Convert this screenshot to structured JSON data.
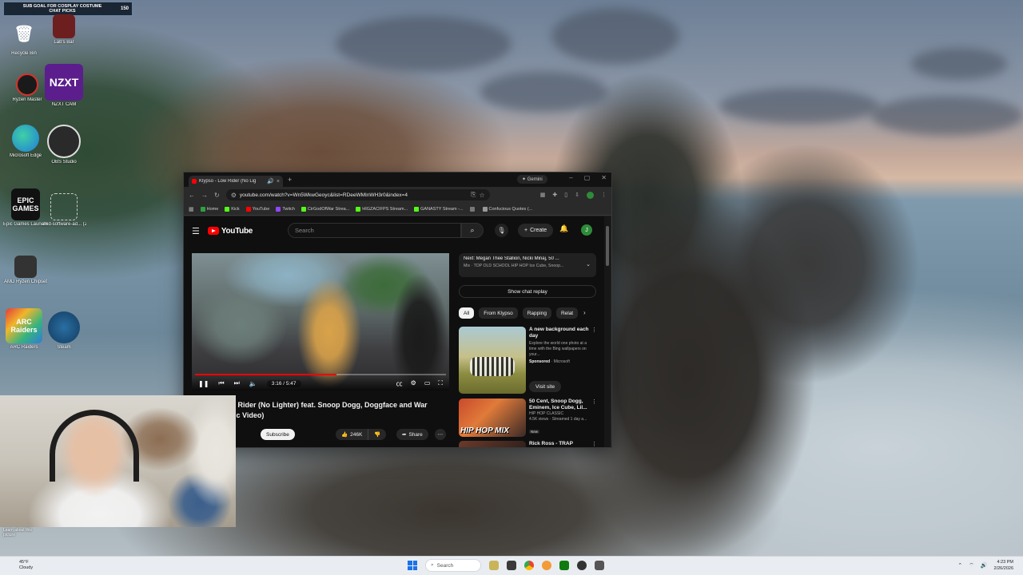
{
  "overlay": {
    "subgoal_text": "SUB GOAL FOR COSPLAY COSTUME\nCHAT PICKS",
    "subgoal_count": "150"
  },
  "desktop_icons": [
    {
      "label": "Recycle Bin"
    },
    {
      "label": "Lab's Bar"
    },
    {
      "label": "Ryzen Master"
    },
    {
      "label": "NZXT CAM"
    },
    {
      "label": "Microsoft Edge"
    },
    {
      "label": "OBS Studio"
    },
    {
      "label": "Epic Games Launcher"
    },
    {
      "label": "amd-software-ad... (2)"
    },
    {
      "label": "AMD Ryzen Chipset"
    },
    {
      "label": "ARC Raiders"
    },
    {
      "label": "Steam"
    }
  ],
  "desktop_glyphs": {
    "nzxt": "NZXT",
    "epic": "EPIC GAMES",
    "arc": "ARC Raiders"
  },
  "browser": {
    "tab_title": "Klypso - Low Rider (No Lig",
    "gemini_label": "Gemini",
    "url": "youtube.com/watch?v=Wn5WkwGeoyc&list=RDeeWMInWH3r0&index=4",
    "bookmarks": [
      {
        "label": "Home",
        "color": "#2ea043"
      },
      {
        "label": "Kick",
        "color": "#53fc18"
      },
      {
        "label": "YouTube",
        "color": "#ff0000"
      },
      {
        "label": "Twitch",
        "color": "#9146ff"
      },
      {
        "label": "CirGodOfWar Strea...",
        "color": "#53fc18"
      },
      {
        "label": "HIGZACIFPS Stream...",
        "color": "#53fc18"
      },
      {
        "label": "GANASTY Stream -...",
        "color": "#53fc18"
      },
      {
        "label": "",
        "color": "#777777"
      },
      {
        "label": "Confucious Quotes (...",
        "color": "#999999"
      }
    ]
  },
  "youtube": {
    "logo_text": "YouTube",
    "search_placeholder": "Search",
    "create_label": "Create",
    "avatar_letter": "J",
    "player": {
      "time": "3:16 / 5:47",
      "progress": 0.565
    },
    "video_title": "w Rider (No Lighter) feat. Snoop Dogg, Doggface and War\nsic Video)",
    "subscribe_label": "Subscribe",
    "like_count": "246K",
    "share_label": "Share",
    "next_up": {
      "title": "Next: Megan Thee Stallion, Nicki Minaj, 50 ...",
      "subtitle": "Mix · TOP OLD SCHOOL HIP HOP Ice Cube, Snoop..."
    },
    "chat_replay_label": "Show chat replay",
    "chips": [
      "All",
      "From Klypso",
      "Rapping",
      "Relat"
    ],
    "ad": {
      "title": "A new background each day",
      "desc": "Explore the world one photo at a time with the Bing wallpapers on your...",
      "sponsored": "Sponsored",
      "advertiser": "Microsoft",
      "visit_label": "Visit site"
    },
    "rec1": {
      "title": "50 Cent, Snoop Dogg, Eminem, Ice Cube, Lil...",
      "channel": "HIP HOP CLASSIC",
      "meta": "4.5K views · Streamed 1 day a...",
      "badge": "New",
      "thumb_text": "HIP HOP MIX"
    },
    "rec2": {
      "title": "Rick Ross - TRAP"
    }
  },
  "desktop_footer": {
    "learn_more": "Learn about this\npicture"
  },
  "taskbar": {
    "weather_temp": "45°F",
    "weather_desc": "Cloudy",
    "search_label": "Search",
    "time": "4:23 PM",
    "date": "2/26/2026"
  }
}
